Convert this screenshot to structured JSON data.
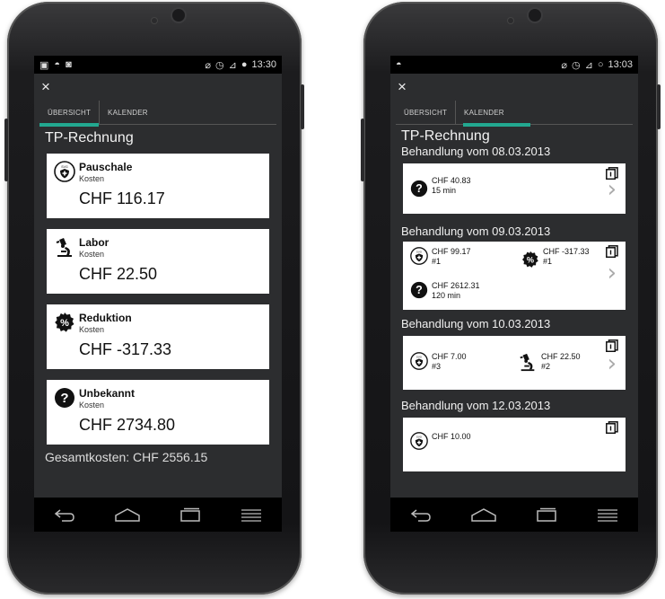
{
  "colors": {
    "accent": "#22a890",
    "screen_bg": "#2c2d2f",
    "card_bg": "#ffffff"
  },
  "left": {
    "status": {
      "time": "13:30"
    },
    "close_label": "×",
    "tabs": [
      {
        "label": "ÜBERSICHT",
        "active": true
      },
      {
        "label": "KALENDER",
        "active": false
      }
    ],
    "title": "TP-Rechnung",
    "categories": [
      {
        "icon": "shield-icon",
        "name": "Pauschale",
        "sub": "Kosten",
        "amount": "CHF 116.17"
      },
      {
        "icon": "microscope-icon",
        "name": "Labor",
        "sub": "Kosten",
        "amount": "CHF 22.50"
      },
      {
        "icon": "percent-badge-icon",
        "name": "Reduktion",
        "sub": "Kosten",
        "amount": "CHF -317.33"
      },
      {
        "icon": "question-icon",
        "name": "Unbekannt",
        "sub": "Kosten",
        "amount": "CHF 2734.80"
      }
    ],
    "total": "Gesamtkosten: CHF 2556.15"
  },
  "right": {
    "status": {
      "time": "13:03"
    },
    "close_label": "×",
    "tabs": [
      {
        "label": "ÜBERSICHT",
        "active": false
      },
      {
        "label": "KALENDER",
        "active": true
      }
    ],
    "title": "TP-Rechnung",
    "groups": [
      {
        "date": "Behandlung vom 08.03.2013",
        "entries": [
          {
            "icon": "question-icon",
            "amount": "CHF 40.83",
            "detail": "15 min"
          }
        ]
      },
      {
        "date": "Behandlung vom 09.03.2013",
        "entries": [
          {
            "icon": "shield-icon",
            "amount": "CHF 99.17",
            "detail": "#1"
          },
          {
            "icon": "percent-badge-icon",
            "amount": "CHF -317.33",
            "detail": "#1"
          },
          {
            "icon": "question-icon",
            "amount": "CHF 2612.31",
            "detail": "120 min"
          }
        ]
      },
      {
        "date": "Behandlung vom 10.03.2013",
        "entries": [
          {
            "icon": "shield-icon",
            "amount": "CHF 7.00",
            "detail": "#3"
          },
          {
            "icon": "microscope-icon",
            "amount": "CHF 22.50",
            "detail": "#2"
          }
        ]
      },
      {
        "date": "Behandlung vom 12.03.2013",
        "entries": [
          {
            "icon": "shield-icon",
            "amount": "CHF 10.00",
            "detail": ""
          }
        ]
      }
    ]
  }
}
